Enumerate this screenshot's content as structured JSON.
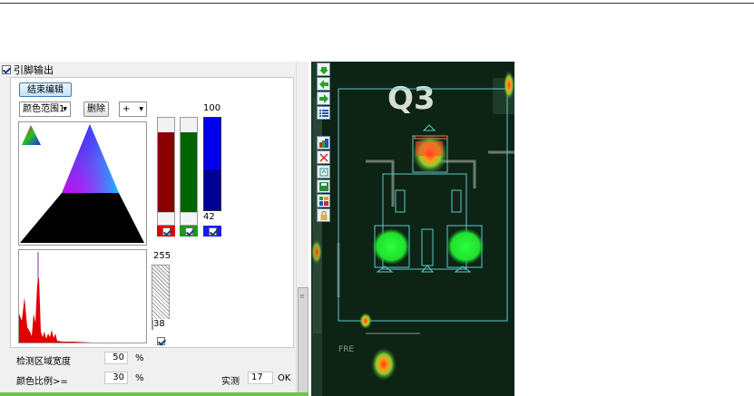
{
  "panel": {
    "pin_output_label": "引脚输出",
    "pin_output_checked": true,
    "finish_edit_button": "结束编辑",
    "color_range_selected": "颜色范围1",
    "delete_button": "删除",
    "add_button": "+"
  },
  "color_bars": {
    "red": {
      "color": "#8b0000",
      "level": 0.75,
      "checked": true
    },
    "green": {
      "color": "#006400",
      "level": 0.75,
      "checked": true
    },
    "blue": {
      "color": "#0000ee",
      "upper_value": "100",
      "lower_value": "42",
      "checked": true
    }
  },
  "histogram_scale": {
    "max_value": "255",
    "min_value": "38",
    "checked": true
  },
  "detect_width": {
    "label": "检测区域宽度",
    "value": "50",
    "unit": "%"
  },
  "color_ratio": {
    "label": "颜色比例>=",
    "value": "30",
    "unit": "%",
    "measured_label": "实测",
    "measured_value": "17",
    "ok_label": "OK"
  },
  "image_view": {
    "component_label": "Q3"
  },
  "toolbar_icons": [
    "arrow-down-icon",
    "arrow-left-icon",
    "arrow-right-icon",
    "list-icon",
    "image-icon",
    "cut-icon",
    "export-icon",
    "save-icon",
    "grid-icon",
    "lock-icon"
  ]
}
